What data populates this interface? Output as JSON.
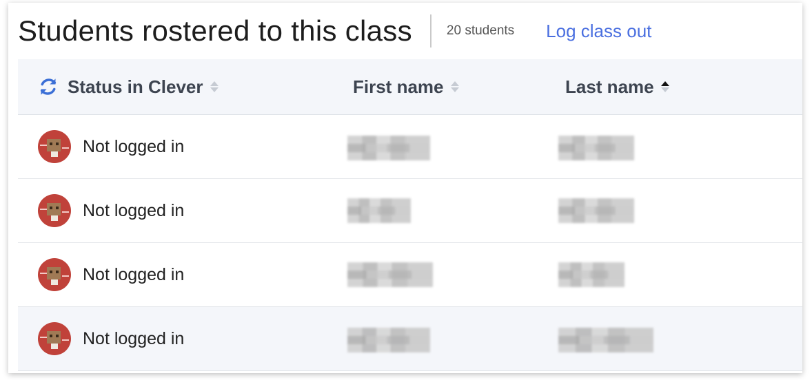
{
  "header": {
    "title": "Students rostered to this class",
    "count": "20 students",
    "logout_label": "Log class out"
  },
  "table": {
    "columns": [
      {
        "label": "Status in Clever",
        "sort": "none",
        "icon": "refresh-icon"
      },
      {
        "label": "First name",
        "sort": "none"
      },
      {
        "label": "Last name",
        "sort": "ascending"
      }
    ],
    "rows": [
      {
        "status": "Not logged in",
        "avatar": "robot-avatar"
      },
      {
        "status": "Not logged in",
        "avatar": "robot-avatar"
      },
      {
        "status": "Not logged in",
        "avatar": "robot-avatar"
      },
      {
        "status": "Not logged in",
        "avatar": "robot-avatar"
      }
    ]
  },
  "colors": {
    "accent": "#4a6fe0",
    "header_bg": "#f4f6fa",
    "avatar_bg": "#c0423a"
  }
}
